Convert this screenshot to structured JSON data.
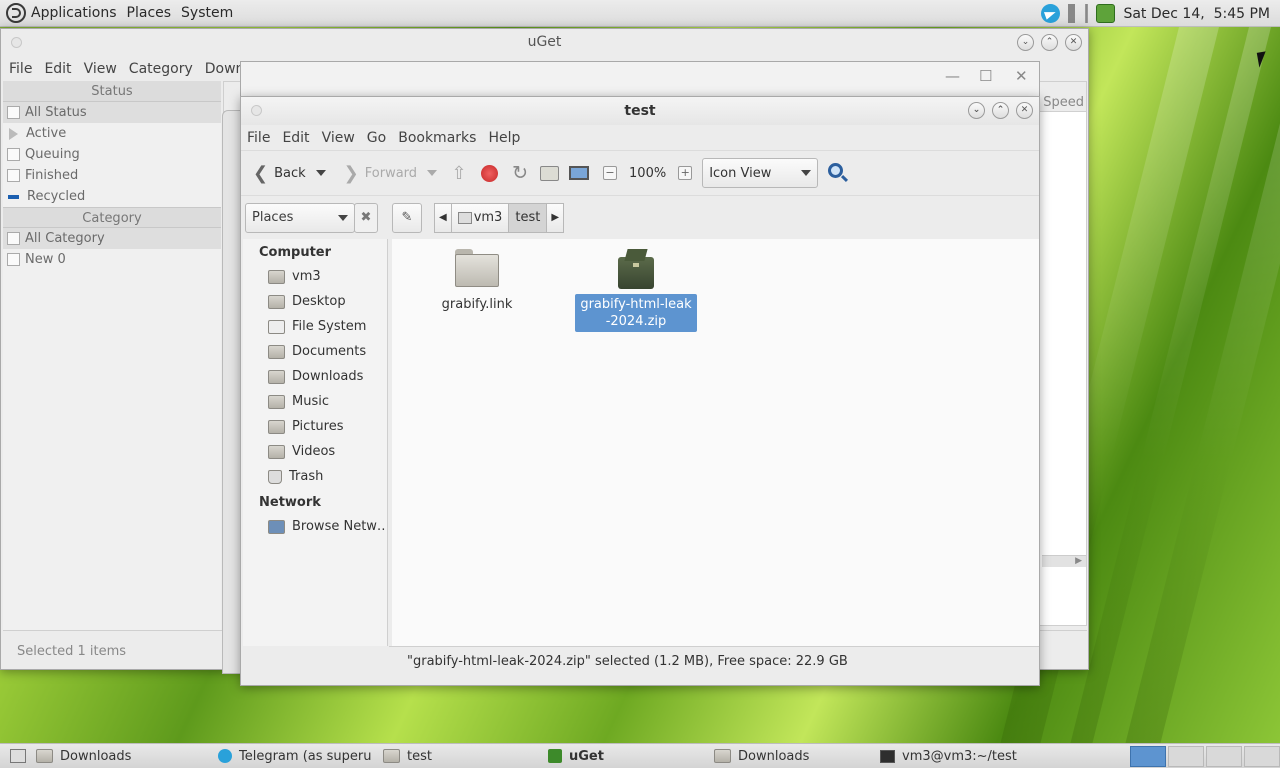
{
  "top_panel": {
    "menus": [
      "Applications",
      "Places",
      "System"
    ],
    "clock": "Sat Dec 14,  5:45 PM"
  },
  "uget": {
    "title": "uGet",
    "menus": [
      "File",
      "Edit",
      "View",
      "Category",
      "Downloa"
    ],
    "status_header": "Status",
    "status_items": [
      "All Status",
      "Active",
      "Queuing",
      "Finished",
      "Recycled"
    ],
    "category_header": "Category",
    "category_items": [
      "All Category",
      "New 0"
    ],
    "speed_column": "o Speed",
    "statusbar": "Selected 1 items"
  },
  "caja": {
    "title": "test",
    "menus": [
      "File",
      "Edit",
      "View",
      "Go",
      "Bookmarks",
      "Help"
    ],
    "toolbar": {
      "back": "Back",
      "forward": "Forward",
      "zoom": "100%",
      "view_mode": "Icon View"
    },
    "sidebar_mode": "Places",
    "path": [
      "vm3",
      "test"
    ],
    "places": {
      "computer_header": "Computer",
      "computer_items": [
        "vm3",
        "Desktop",
        "File System",
        "Documents",
        "Downloads",
        "Music",
        "Pictures",
        "Videos",
        "Trash"
      ],
      "network_header": "Network",
      "network_items": [
        "Browse Netw…"
      ]
    },
    "files": [
      {
        "name": "grabify.link",
        "kind": "folder",
        "selected": false
      },
      {
        "name": "grabify-html-leak-2024.zip",
        "kind": "archive",
        "selected": true
      }
    ],
    "statusbar": "\"grabify-html-leak-2024.zip\" selected (1.2 MB), Free space: 22.9 GB"
  },
  "taskbar": {
    "items": [
      {
        "label": "Downloads",
        "icon": "folder-icon"
      },
      {
        "label": "Telegram (as superu…",
        "icon": "telegram-icon"
      },
      {
        "label": "test",
        "icon": "folder-icon"
      },
      {
        "label": "uGet",
        "icon": "uget-icon"
      },
      {
        "label": "Downloads",
        "icon": "folder-icon"
      },
      {
        "label": "vm3@vm3:~/test",
        "icon": "terminal-icon"
      }
    ]
  },
  "colors": {
    "selection": "#5d94d0",
    "telegram": "#2aa1da",
    "uget": "#3d8a2a"
  }
}
